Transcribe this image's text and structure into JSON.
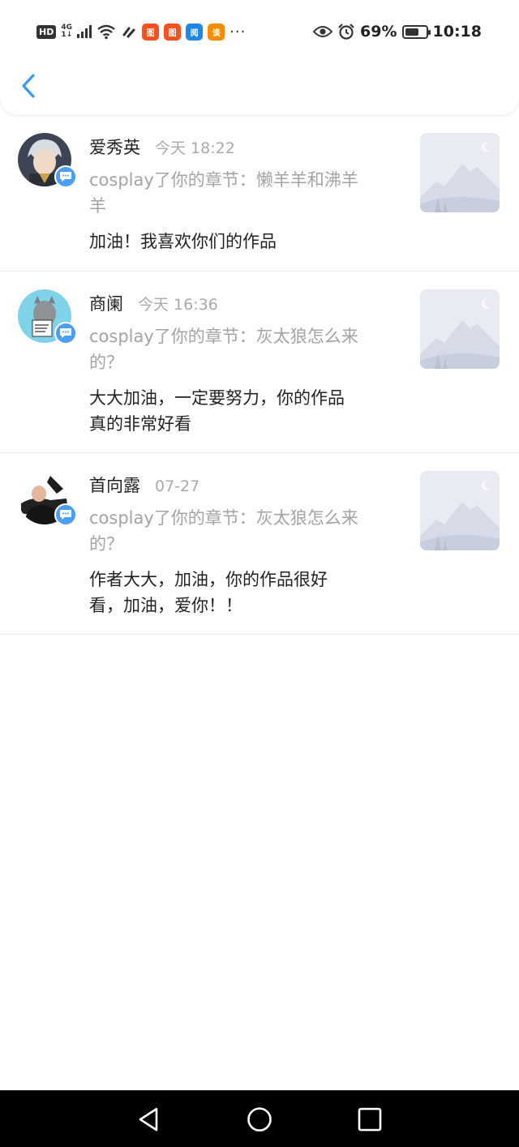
{
  "status_bar": {
    "hd": "HD",
    "network": "4G",
    "network_sub": "1↓",
    "app_icon_labels": [
      "图",
      "图",
      "阅",
      "谈"
    ],
    "more": "···",
    "battery_percent": "69%",
    "battery_level": 0.69,
    "time": "10:18"
  },
  "colors": {
    "accent": "#4b9ef5",
    "back_arrow": "#3a9ae8",
    "text_primary": "#222222",
    "text_secondary": "#a3a3a3"
  },
  "comments": [
    {
      "name": "爱秀英",
      "time": "今天 18:22",
      "chapter_prefix": "cosplay了你的章节：懒羊羊和沸羊",
      "chapter_suffix": "羊",
      "comment_line1": "加油！我喜欢你们的作品",
      "comment_line2": ""
    },
    {
      "name": "商阑",
      "time": "今天 16:36",
      "chapter_prefix": "cosplay了你的章节：灰太狼怎么来",
      "chapter_suffix": "的？",
      "comment_line1": "大大加油，一定要努力，你的作品",
      "comment_line2": "真的非常好看"
    },
    {
      "name": "首向露",
      "time": "07-27",
      "chapter_prefix": "cosplay了你的章节：灰太狼怎么来",
      "chapter_suffix": "的？",
      "comment_line1": "作者大大，加油，你的作品很好",
      "comment_line2": "看，加油，爱你！！"
    }
  ]
}
